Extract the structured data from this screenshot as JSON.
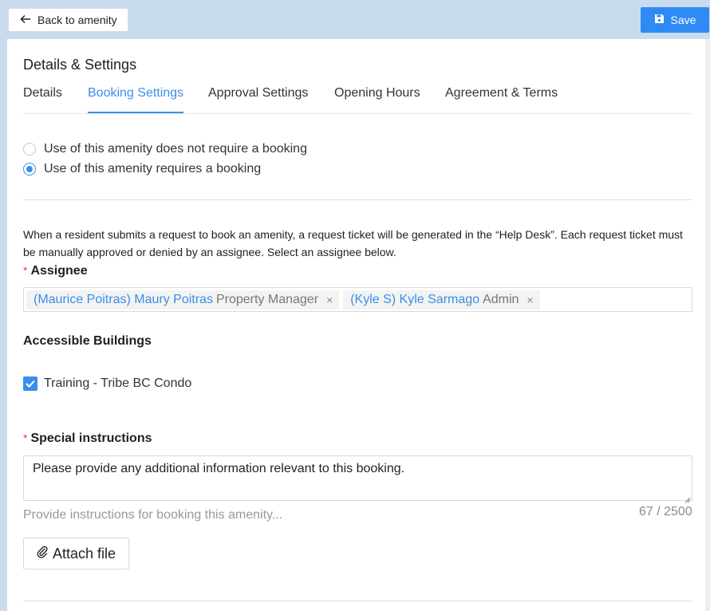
{
  "header": {
    "back_label": "Back to amenity",
    "save_label": "Save"
  },
  "panel": {
    "title": "Details & Settings",
    "tabs": [
      {
        "label": "Details",
        "active": false
      },
      {
        "label": "Booking Settings",
        "active": true
      },
      {
        "label": "Approval Settings",
        "active": false
      },
      {
        "label": "Opening Hours",
        "active": false
      },
      {
        "label": "Agreement & Terms",
        "active": false
      }
    ]
  },
  "booking": {
    "options": [
      {
        "label": "Use of this amenity does not require a booking",
        "selected": false
      },
      {
        "label": "Use of this amenity requires a booking",
        "selected": true
      }
    ],
    "description": "When a resident submits a request to book an amenity, a request ticket will be generated in the “Help Desk”. Each request ticket must be manually approved or denied by an assignee. Select an assignee below.",
    "assignee_label": "Assignee",
    "assignees": [
      {
        "name": "(Maurice Poitras) Maury  Poitras",
        "role": "Property Manager"
      },
      {
        "name": "(Kyle S) Kyle  Sarmago",
        "role": "Admin"
      }
    ],
    "remove_symbol": "×"
  },
  "buildings": {
    "label": "Accessible Buildings",
    "items": [
      {
        "label": "Training - Tribe BC Condo",
        "checked": true
      }
    ]
  },
  "instructions": {
    "label": "Special instructions",
    "value": "Please provide any additional information relevant to this booking.",
    "helper": "Provide instructions for booking this amenity...",
    "counter": "67 / 2500",
    "attach_label": "Attach file"
  },
  "colors": {
    "accent": "#3a8fe8",
    "save_button": "#2f8af4",
    "required_star": "#e8394a",
    "page_background": "#c9dcef"
  },
  "icons": {
    "back": "arrow-left-icon",
    "save": "floppy-disk-icon",
    "attach": "paperclip-icon",
    "check": "checkmark-icon"
  }
}
